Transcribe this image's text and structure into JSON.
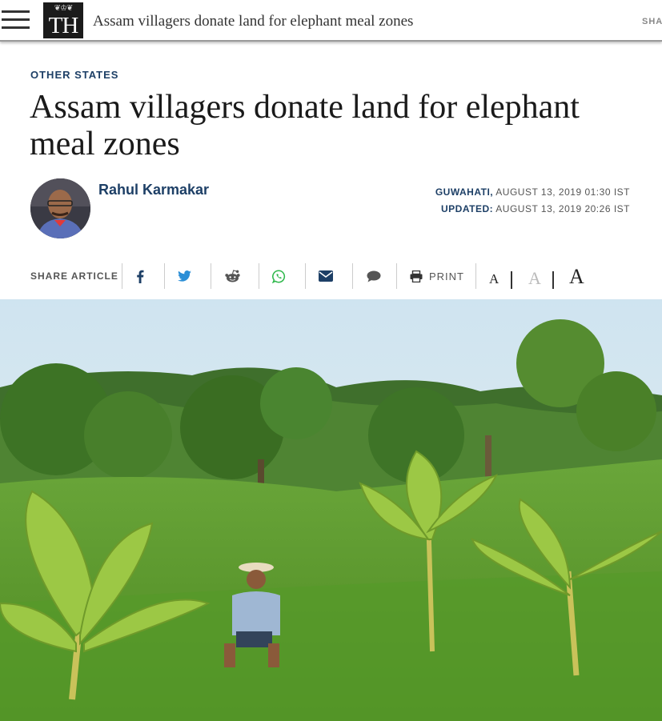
{
  "header": {
    "logo_text": "TH",
    "headline": "Assam villagers donate land for elephant meal zones",
    "share_label": "SHA"
  },
  "article": {
    "section": "OTHER STATES",
    "title": "Assam villagers donate land for elephant meal zones",
    "author": "Rahul Karmakar",
    "location": "GUWAHATI,",
    "published": "AUGUST 13, 2019 01:30 IST",
    "updated_label": "UPDATED:",
    "updated": "AUGUST 13, 2019 20:26 IST"
  },
  "sharebar": {
    "label": "SHARE ARTICLE",
    "buttons": [
      "facebook-icon",
      "twitter-icon",
      "reddit-icon",
      "whatsapp-icon",
      "email-icon",
      "comment-icon",
      "print-icon"
    ],
    "print_label": "PRINT",
    "font_sizes": [
      "A",
      "A",
      "A"
    ]
  },
  "colors": {
    "accent": "#1d3f66",
    "facebook": "#1d3f66",
    "twitter": "#2c8fd6",
    "whatsapp": "#2fb84c"
  }
}
